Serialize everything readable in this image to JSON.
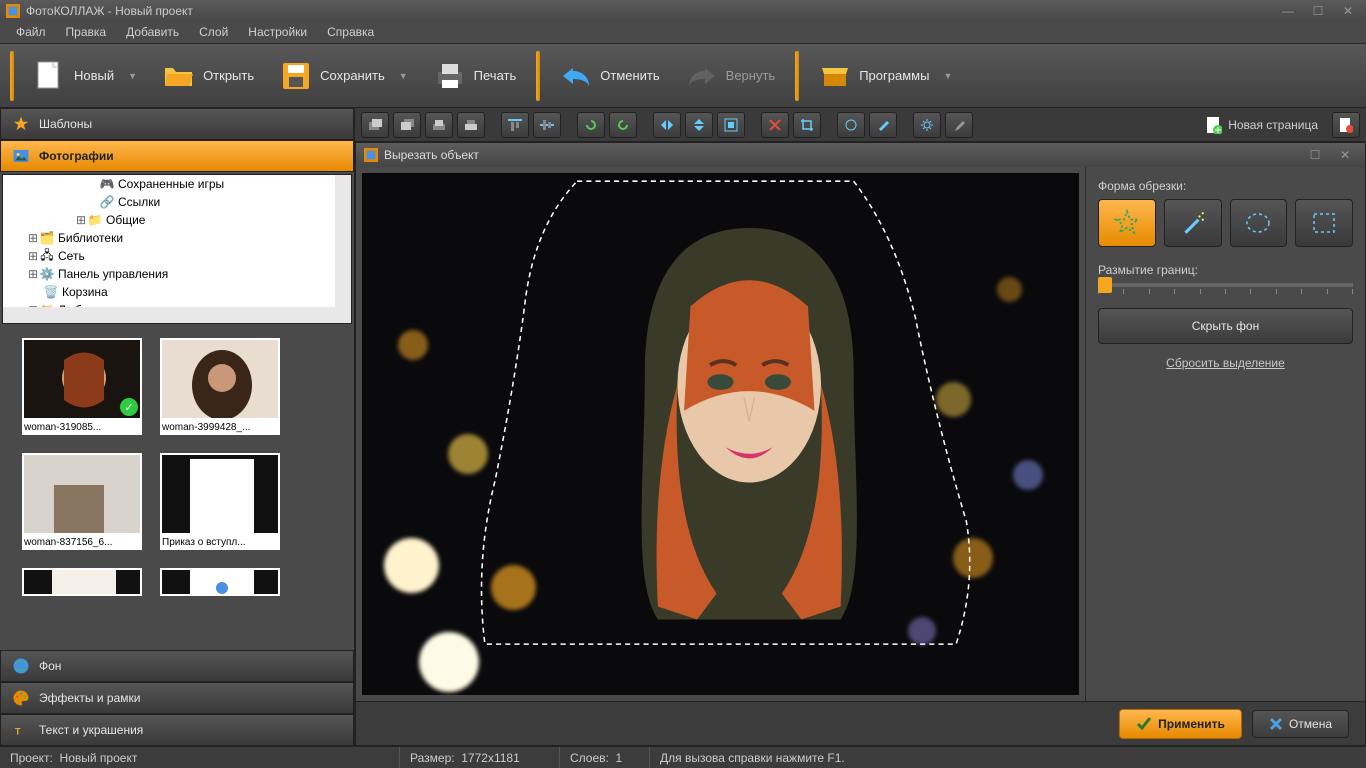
{
  "window": {
    "title": "ФотоКОЛЛАЖ - Новый проект"
  },
  "menu": {
    "file": "Файл",
    "edit": "Правка",
    "add": "Добавить",
    "layer": "Слой",
    "settings": "Настройки",
    "help": "Справка"
  },
  "toolbar": {
    "new": "Новый",
    "open": "Открыть",
    "save": "Сохранить",
    "print": "Печать",
    "undo": "Отменить",
    "redo": "Вернуть",
    "programs": "Программы"
  },
  "left": {
    "templates": "Шаблоны",
    "photos": "Фотографии",
    "background": "Фон",
    "effects": "Эффекты и рамки",
    "text": "Текст и украшения",
    "tree": {
      "saved_games": "Сохраненные игры",
      "links": "Ссылки",
      "shared": "Общие",
      "libraries": "Библиотеки",
      "network": "Сеть",
      "control_panel": "Панель управления",
      "recycle": "Корзина",
      "lyuba": "Люба"
    },
    "thumbs": [
      "woman-319085...",
      "woman-3999428_...",
      "woman-837156_6...",
      "Приказ о вступл...",
      "",
      ""
    ]
  },
  "right": {
    "new_page": "Новая страница"
  },
  "cut": {
    "title": "Вырезать объект",
    "shape_label": "Форма обрезки:",
    "blur_label": "Размытие границ:",
    "hide_bg": "Скрыть фон",
    "reset": "Сбросить выделение",
    "apply": "Применить",
    "cancel": "Отмена"
  },
  "status": {
    "project_label": "Проект:",
    "project_name": "Новый проект",
    "size_label": "Размер:",
    "size_value": "1772x1181",
    "layers_label": "Слоев:",
    "layers_value": "1",
    "help": "Для вызова справки нажмите F1."
  }
}
